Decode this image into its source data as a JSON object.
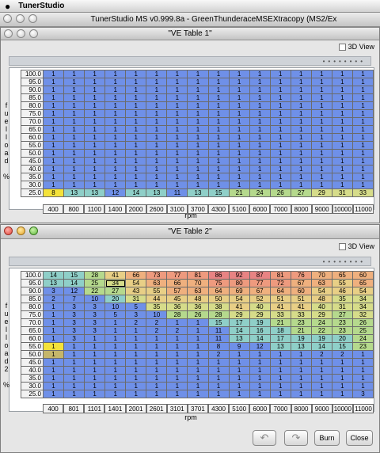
{
  "menubar": {
    "apple": "",
    "app": "TunerStudio"
  },
  "main_window": {
    "title": "TunerStudio MS v0.999.8a - GreenThunderaceMSEXtracopy (MS2/Ex"
  },
  "ve1": {
    "title": "\"VE Table 1\"",
    "view3d": "3D View",
    "y_axis_label": "fuelload %",
    "x_axis_label": "rpm",
    "loads": [
      "100.0",
      "95.0",
      "90.0",
      "85.0",
      "80.0",
      "75.0",
      "70.0",
      "65.0",
      "60.0",
      "55.0",
      "50.0",
      "45.0",
      "40.0",
      "35.0",
      "30.0",
      "25.0"
    ],
    "rpms": [
      "400",
      "800",
      "1100",
      "1400",
      "2000",
      "2600",
      "3100",
      "3700",
      "4300",
      "5100",
      "6000",
      "7000",
      "8000",
      "9000",
      "10000",
      "11000"
    ],
    "last_row": [
      "8",
      "13",
      "13",
      "12",
      "14",
      "13",
      "11",
      "13",
      "15",
      "21",
      "24",
      "26",
      "27",
      "29",
      "31",
      "33"
    ]
  },
  "ve2": {
    "title": "\"VE Table 2\"",
    "view3d": "3D View",
    "y_axis_label": "fuelload2 %",
    "x_axis_label": "rpm",
    "loads": [
      "100.0",
      "95.0",
      "90.0",
      "85.0",
      "80.0",
      "75.0",
      "70.0",
      "65.0",
      "60.0",
      "55.0",
      "50.0",
      "45.0",
      "40.0",
      "35.0",
      "30.0",
      "25.0"
    ],
    "rpms": [
      "400",
      "801",
      "1101",
      "1401",
      "2001",
      "2601",
      "3101",
      "3701",
      "4300",
      "5100",
      "6000",
      "7000",
      "8000",
      "9000",
      "10000",
      "11000"
    ],
    "rows": [
      [
        "14",
        "15",
        "28",
        "41",
        "66",
        "73",
        "77",
        "81",
        "86",
        "92",
        "87",
        "81",
        "76",
        "70",
        "65",
        "60"
      ],
      [
        "13",
        "14",
        "25",
        "34",
        "54",
        "63",
        "66",
        "70",
        "75",
        "80",
        "77",
        "72",
        "67",
        "63",
        "55",
        "65"
      ],
      [
        "3",
        "12",
        "22",
        "27",
        "43",
        "55",
        "57",
        "63",
        "64",
        "69",
        "67",
        "64",
        "60",
        "54",
        "46",
        "54"
      ],
      [
        "2",
        "7",
        "10",
        "20",
        "31",
        "44",
        "45",
        "48",
        "50",
        "54",
        "52",
        "51",
        "51",
        "48",
        "35",
        "34"
      ],
      [
        "1",
        "3",
        "3",
        "10",
        "5",
        "35",
        "36",
        "36",
        "38",
        "41",
        "40",
        "41",
        "41",
        "40",
        "31",
        "34"
      ],
      [
        "1",
        "3",
        "3",
        "5",
        "3",
        "10",
        "28",
        "26",
        "28",
        "29",
        "29",
        "33",
        "33",
        "29",
        "27",
        "32"
      ],
      [
        "1",
        "3",
        "3",
        "1",
        "2",
        "2",
        "1",
        "1",
        "15",
        "17",
        "19",
        "21",
        "23",
        "24",
        "23",
        "26"
      ],
      [
        "1",
        "3",
        "3",
        "1",
        "1",
        "2",
        "2",
        "1",
        "11",
        "14",
        "16",
        "18",
        "21",
        "22",
        "23",
        "25"
      ],
      [
        "1",
        "3",
        "1",
        "1",
        "1",
        "1",
        "1",
        "1",
        "11",
        "13",
        "14",
        "17",
        "19",
        "19",
        "20",
        "24"
      ],
      [
        "1",
        "1",
        "1",
        "1",
        "1",
        "1",
        "1",
        "1",
        "8",
        "9",
        "12",
        "13",
        "13",
        "14",
        "15",
        "23"
      ],
      [
        "1",
        "1",
        "1",
        "1",
        "1",
        "1",
        "1",
        "1",
        "2",
        "1",
        "1",
        "1",
        "1",
        "2",
        "2",
        "1"
      ],
      [
        "1",
        "1",
        "1",
        "1",
        "1",
        "1",
        "1",
        "1",
        "1",
        "1",
        "1",
        "1",
        "1",
        "1",
        "1",
        "1"
      ],
      [
        "1",
        "1",
        "1",
        "1",
        "1",
        "1",
        "1",
        "1",
        "1",
        "1",
        "1",
        "1",
        "1",
        "1",
        "1",
        "1"
      ],
      [
        "1",
        "1",
        "1",
        "1",
        "1",
        "1",
        "1",
        "1",
        "1",
        "1",
        "1",
        "1",
        "1",
        "1",
        "1",
        "1"
      ],
      [
        "1",
        "1",
        "1",
        "1",
        "1",
        "1",
        "1",
        "1",
        "1",
        "1",
        "1",
        "1",
        "1",
        "1",
        "1",
        "1"
      ],
      [
        "1",
        "1",
        "1",
        "1",
        "1",
        "1",
        "1",
        "1",
        "1",
        "1",
        "1",
        "1",
        "1",
        "1",
        "1",
        "3"
      ]
    ]
  },
  "buttons": {
    "undo": "↶",
    "redo": "↷",
    "burn": "Burn",
    "close": "Close"
  }
}
